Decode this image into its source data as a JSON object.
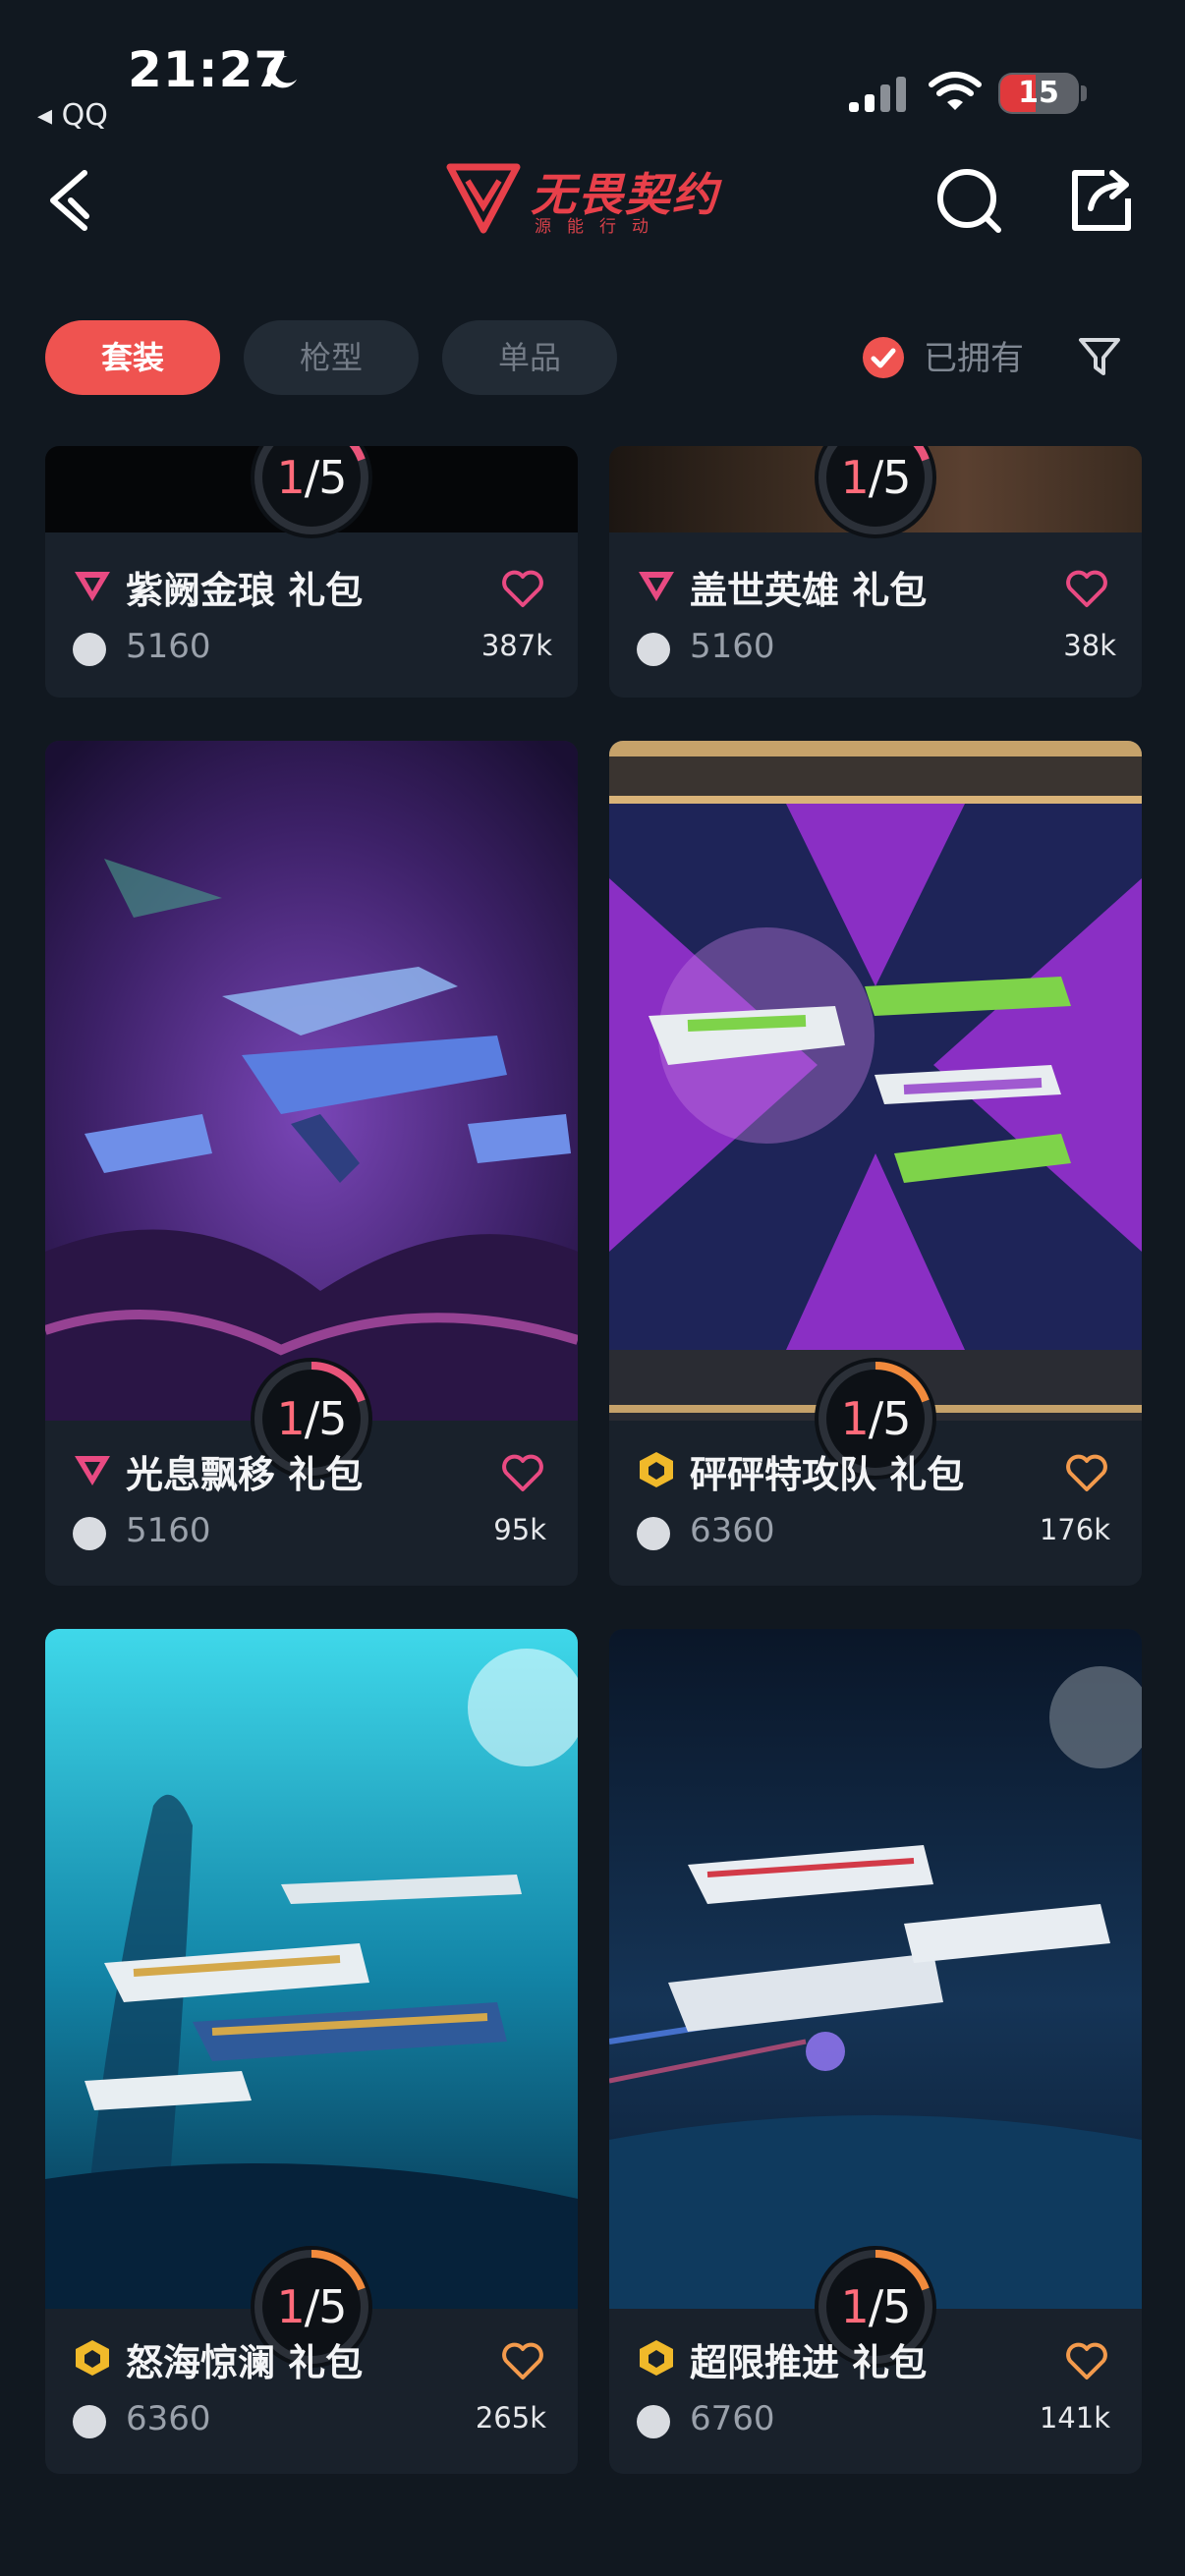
{
  "status_bar": {
    "time": "21:27",
    "back_app": "◂ QQ",
    "battery": "15"
  },
  "header": {
    "logo_title": "无畏契约",
    "logo_subtitle": "源能行动"
  },
  "tabs": [
    {
      "label": "套装",
      "active": true
    },
    {
      "label": "枪型",
      "active": false
    },
    {
      "label": "单品",
      "active": false
    }
  ],
  "filter": {
    "owned_label": "已拥有",
    "owned_checked": true
  },
  "cards": [
    {
      "name": "紫阙金琅 礼包",
      "price": "5160",
      "likes": "387k",
      "rarity": "pink",
      "progress": "1/5"
    },
    {
      "name": "盖世英雄 礼包",
      "price": "5160",
      "likes": "38k",
      "rarity": "pink",
      "progress": "1/5"
    },
    {
      "name": "光息飘移 礼包",
      "price": "5160",
      "likes": "95k",
      "rarity": "pink",
      "progress": "1/5"
    },
    {
      "name": "砰砰特攻队 礼包",
      "price": "6360",
      "likes": "176k",
      "rarity": "gold",
      "progress": "1/5"
    },
    {
      "name": "怒海惊澜 礼包",
      "price": "6360",
      "likes": "265k",
      "rarity": "gold",
      "progress": "1/5"
    },
    {
      "name": "超限推进 礼包",
      "price": "6760",
      "likes": "141k",
      "rarity": "gold",
      "progress": "1/5"
    }
  ],
  "colors": {
    "accent": "#ef5350",
    "pink_rarity": "#e94a82",
    "gold_rarity": "#f0b92a",
    "pink_heart": "#e94a82",
    "orange_heart": "#f39a4c"
  }
}
